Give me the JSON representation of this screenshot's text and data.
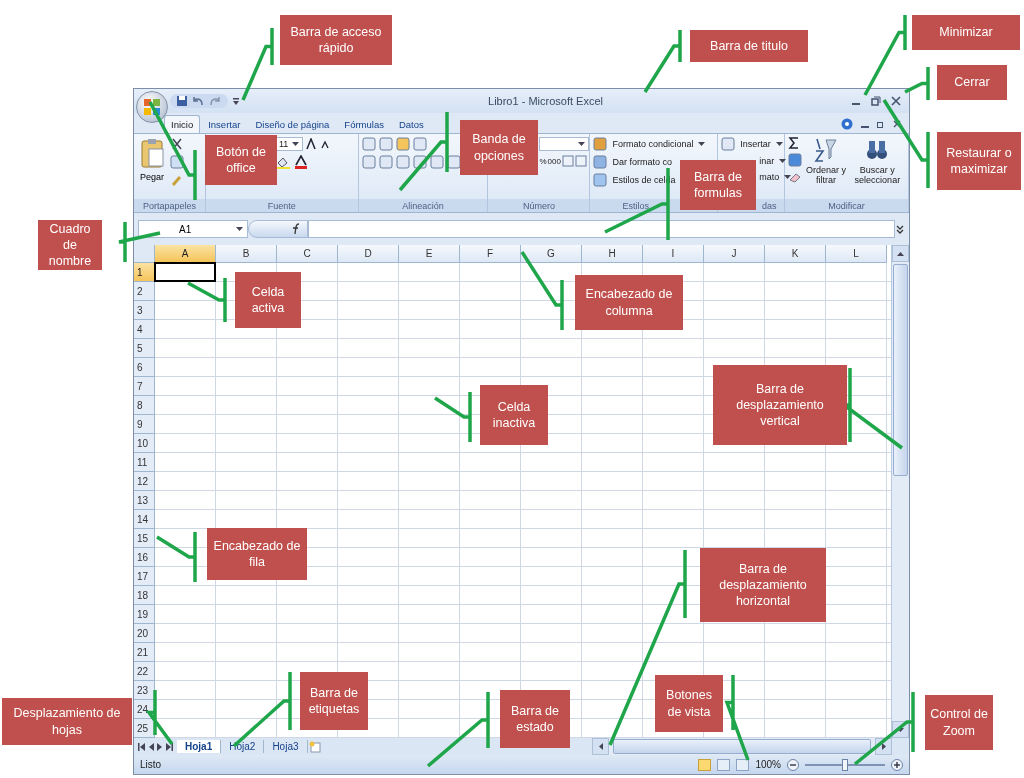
{
  "window": {
    "title": "Libro1 - Microsoft Excel"
  },
  "tabs": [
    {
      "label": "Inicio",
      "selected": true
    },
    {
      "label": "Insertar",
      "selected": false
    },
    {
      "label": "Diseño de página",
      "selected": false
    },
    {
      "label": "Fórmulas",
      "selected": false
    },
    {
      "label": "Datos",
      "selected": false
    }
  ],
  "ribbon": {
    "groups": [
      {
        "label": "Portapapeles",
        "buttons": [
          "Pegar"
        ]
      },
      {
        "label": "Fuente",
        "buttons": [
          "11"
        ]
      },
      {
        "label": "Alineación"
      },
      {
        "label": "Número",
        "buttons": [
          "%",
          "000"
        ]
      },
      {
        "label": "Estilos",
        "buttons": [
          "Formato condicional",
          "Dar formato co",
          "Estilos de celda"
        ]
      },
      {
        "label": "das",
        "buttons": [
          "Insertar",
          "inar",
          "mato"
        ]
      },
      {
        "label": "Modificar",
        "buttons": [
          "Ordenar y filtrar",
          "Buscar y seleccionar"
        ]
      }
    ]
  },
  "formula_bar": {
    "name_box": "A1"
  },
  "columns": [
    {
      "label": "A",
      "selected": true
    },
    {
      "label": "B",
      "selected": false
    },
    {
      "label": "C",
      "selected": false
    },
    {
      "label": "D",
      "selected": false
    },
    {
      "label": "E",
      "selected": false
    },
    {
      "label": "F",
      "selected": false
    },
    {
      "label": "G",
      "selected": false
    },
    {
      "label": "H",
      "selected": false
    },
    {
      "label": "I",
      "selected": false
    },
    {
      "label": "J",
      "selected": false
    },
    {
      "label": "K",
      "selected": false
    },
    {
      "label": "L",
      "selected": false
    }
  ],
  "rows": [
    {
      "label": "1",
      "selected": true
    },
    {
      "label": "2",
      "selected": false
    },
    {
      "label": "3",
      "selected": false
    },
    {
      "label": "4",
      "selected": false
    },
    {
      "label": "5",
      "selected": false
    },
    {
      "label": "6",
      "selected": false
    },
    {
      "label": "7",
      "selected": false
    },
    {
      "label": "8",
      "selected": false
    },
    {
      "label": "9",
      "selected": false
    },
    {
      "label": "10",
      "selected": false
    },
    {
      "label": "11",
      "selected": false
    },
    {
      "label": "12",
      "selected": false
    },
    {
      "label": "13",
      "selected": false
    },
    {
      "label": "14",
      "selected": false
    },
    {
      "label": "15",
      "selected": false
    },
    {
      "label": "16",
      "selected": false
    },
    {
      "label": "17",
      "selected": false
    },
    {
      "label": "18",
      "selected": false
    },
    {
      "label": "19",
      "selected": false
    },
    {
      "label": "20",
      "selected": false
    },
    {
      "label": "21",
      "selected": false
    },
    {
      "label": "22",
      "selected": false
    },
    {
      "label": "23",
      "selected": false
    },
    {
      "label": "24",
      "selected": false
    },
    {
      "label": "25",
      "selected": false
    }
  ],
  "sheet_tabs": [
    {
      "label": "Hoja1",
      "selected": true
    },
    {
      "label": "Hoja2",
      "selected": false
    },
    {
      "label": "Hoja3",
      "selected": false
    }
  ],
  "status_bar": {
    "status": "Listo",
    "view_buttons": [
      {
        "selected": true
      },
      {
        "selected": false
      },
      {
        "selected": false
      }
    ],
    "zoom": "100%",
    "zoom_slider": {
      "level": 0.5
    }
  },
  "annotations": [
    "Barra de acceso rápido",
    "Barra de titulo",
    "Minimizar",
    "Cerrar",
    "Botón de office",
    "Banda de opciones",
    "Barra de formulas",
    "Restaurar o maximizar",
    "Cuadro de nombre",
    "Celda activa",
    "Encabezado de columna",
    "Celda inactiva",
    "Barra de desplazamiento vertical",
    "Encabezado de fila",
    "Barra de desplazamiento horizontal",
    "Desplazamiento de hojas",
    "Barra de etiquetas",
    "Barra de estado",
    "Botones de vista",
    "Control de Zoom"
  ]
}
